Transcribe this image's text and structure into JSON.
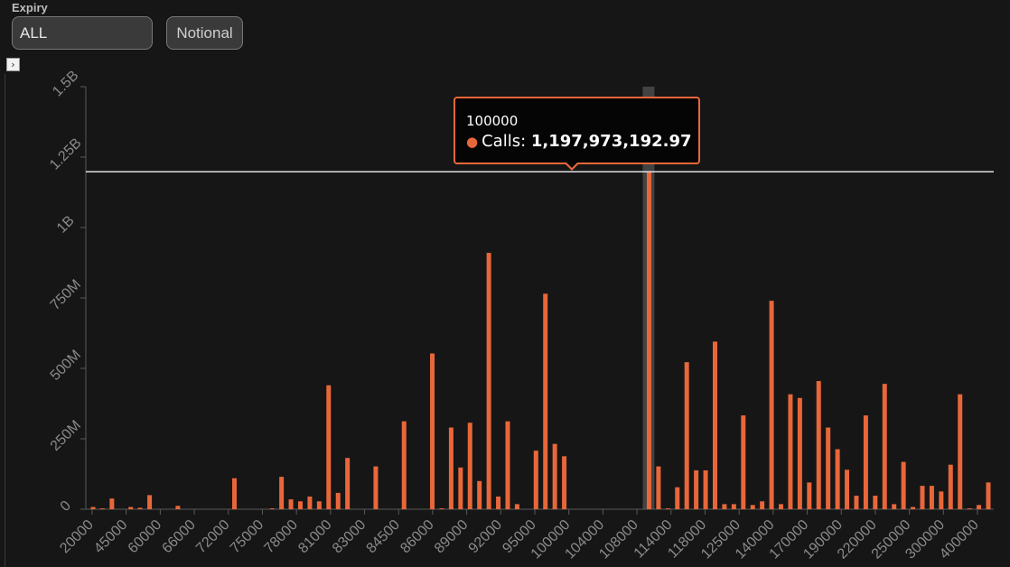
{
  "controls": {
    "expiry_label": "Expiry",
    "expiry_value": "ALL",
    "notional_label": "Notional",
    "expand_glyph": "›"
  },
  "colors": {
    "bar": "#e8673a",
    "background": "#161616",
    "reference_line": "#e0e0e0",
    "hover_band": "#4a4a4a"
  },
  "tooltip": {
    "x_value": "100000",
    "series_label": "Calls:",
    "value": "1,197,973,192.97"
  },
  "chart_data": {
    "type": "bar",
    "series_name": "Calls",
    "ylim": [
      0,
      1500000000
    ],
    "y_ticks": [
      0,
      250000000,
      500000000,
      750000000,
      1000000000,
      1250000000,
      1500000000
    ],
    "y_tick_labels": [
      "0",
      "250M",
      "500M",
      "750M",
      "1B",
      "1.25B",
      "1.5B"
    ],
    "x_tick_labels": [
      "20000",
      "45000",
      "60000",
      "66000",
      "72000",
      "75000",
      "78000",
      "81000",
      "83000",
      "84500",
      "86000",
      "89000",
      "92000",
      "95000",
      "100000",
      "104000",
      "108000",
      "114000",
      "118000",
      "125000",
      "140000",
      "170000",
      "190000",
      "220000",
      "250000",
      "300000",
      "400000"
    ],
    "reference_line_value": 1197973192.97,
    "highlighted_bar_index": 59,
    "values": [
      8000000,
      3000000,
      38000000,
      0,
      8000000,
      5000000,
      50000000,
      0,
      0,
      12000000,
      0,
      0,
      0,
      0,
      0,
      110000000,
      0,
      0,
      0,
      3000000,
      115000000,
      35000000,
      28000000,
      45000000,
      28000000,
      440000000,
      58000000,
      182000000,
      0,
      0,
      152000000,
      0,
      0,
      312000000,
      0,
      0,
      553000000,
      3000000,
      290000000,
      148000000,
      307000000,
      100000000,
      910000000,
      45000000,
      312000000,
      18000000,
      0,
      208000000,
      765000000,
      232000000,
      188000000,
      0,
      0,
      0,
      0,
      0,
      0,
      0,
      0,
      1197973192.97,
      152000000,
      3000000,
      78000000,
      522000000,
      138000000,
      138000000,
      595000000,
      18000000,
      18000000,
      333000000,
      15000000,
      28000000,
      740000000,
      18000000,
      408000000,
      395000000,
      95000000,
      455000000,
      290000000,
      213000000,
      140000000,
      48000000,
      333000000,
      48000000,
      445000000,
      18000000,
      168000000,
      8000000,
      83000000,
      83000000,
      63000000,
      158000000,
      408000000,
      3000000,
      15000000,
      95000000
    ]
  }
}
